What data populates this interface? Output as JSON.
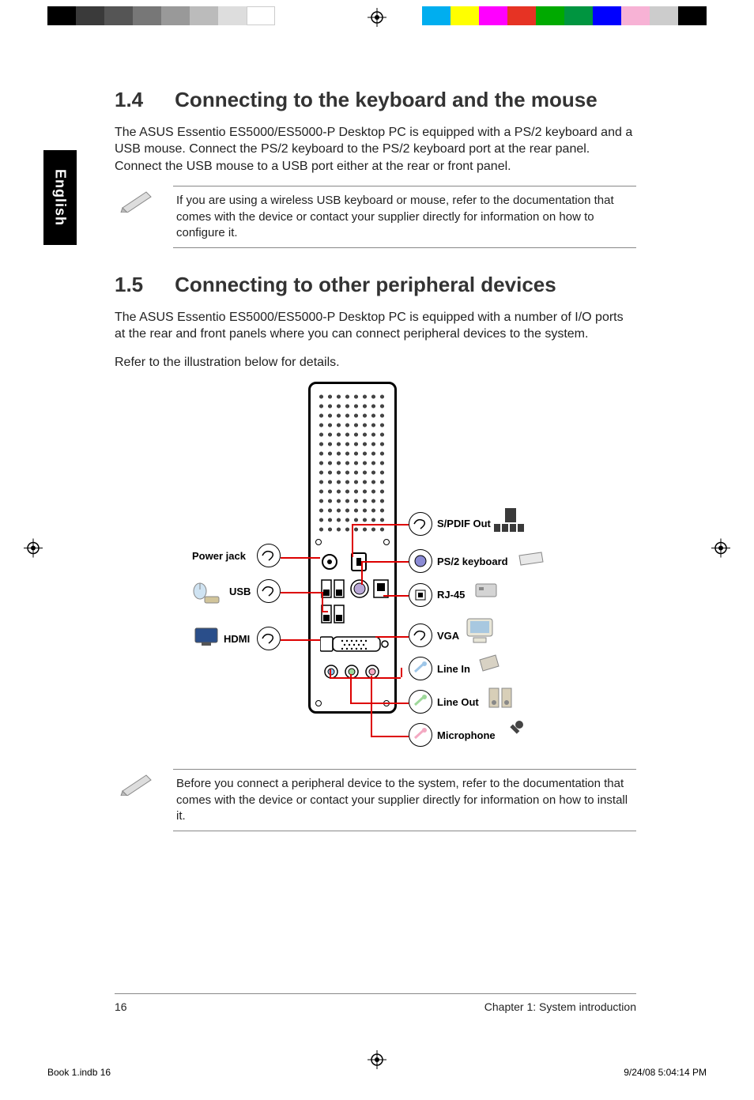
{
  "lang_tab": "English",
  "section1": {
    "number": "1.4",
    "title": "Connecting to the keyboard and the mouse",
    "body": "The ASUS Essentio ES5000/ES5000-P Desktop PC is equipped with a PS/2 keyboard and a USB mouse. Connect the PS/2 keyboard to the PS/2 keyboard port at the rear panel. Connect the USB mouse to a USB port either at the rear or front panel.",
    "note": "If you are using a wireless USB keyboard or mouse, refer to the documentation that comes with the device or contact your supplier directly for information on how to configure it."
  },
  "section2": {
    "number": "1.5",
    "title": "Connecting to other peripheral devices",
    "body1": "The ASUS Essentio ES5000/ES5000-P Desktop PC is equipped with a number of I/O ports at the rear and front panels where you can connect peripheral devices to the system.",
    "body2": "Refer to the illustration below for details.",
    "note": "Before you connect a peripheral device to the system, refer to the documentation that comes with the device or contact your supplier directly for information on how to install it."
  },
  "diagram": {
    "left_labels": {
      "power": "Power jack",
      "usb": "USB",
      "hdmi": "HDMI"
    },
    "right_labels": {
      "spdif": "S/PDIF Out",
      "ps2": "PS/2 keyboard",
      "rj45": "RJ-45",
      "vga": "VGA",
      "linein": "Line In",
      "lineout": "Line Out",
      "mic": "Microphone"
    }
  },
  "footer": {
    "page_number": "16",
    "chapter": "Chapter 1: System introduction"
  },
  "print_footer": {
    "file": "Book 1.indb   16",
    "timestamp": "9/24/08   5:04:14 PM"
  },
  "colors": {
    "callout_line": "#d00"
  }
}
